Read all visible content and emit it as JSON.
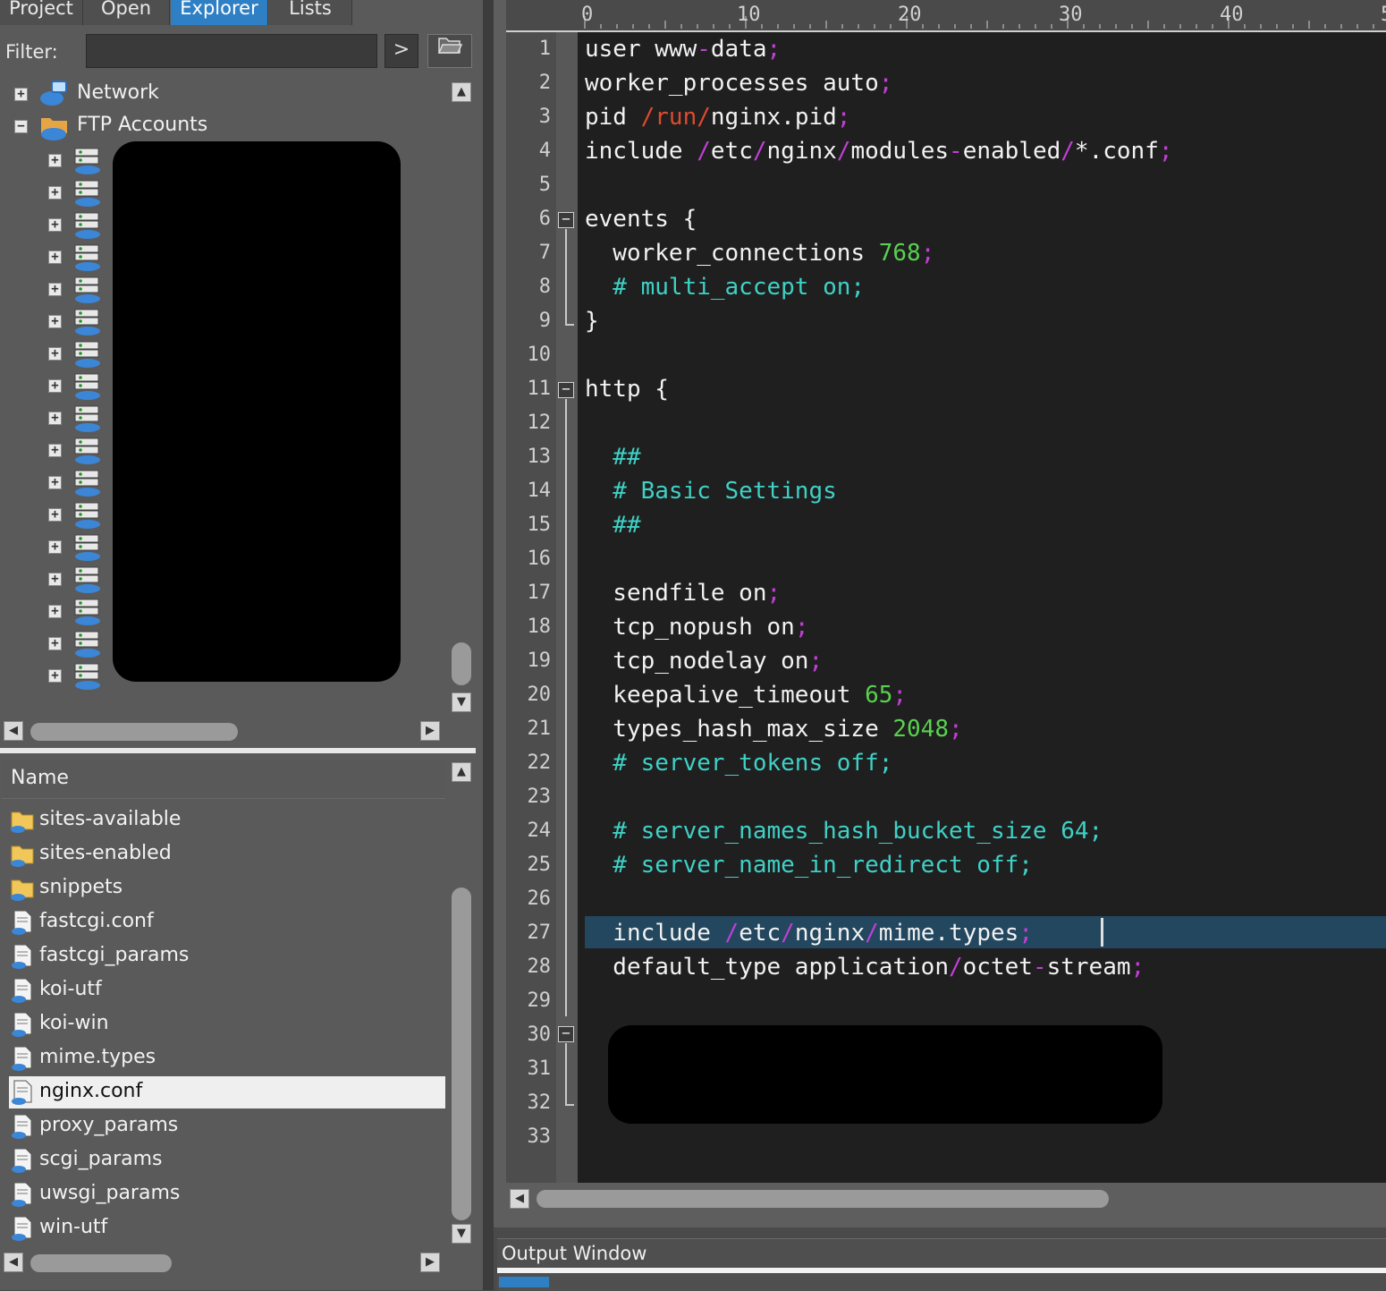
{
  "left_panel": {
    "tabs": [
      "Project",
      "Open",
      "Explorer",
      "Lists"
    ],
    "active_tab": "Explorer",
    "filter": {
      "label": "Filter:",
      "value": "",
      "go_glyph": ">"
    },
    "tree": {
      "network_label": "Network",
      "ftp_label": "FTP Accounts",
      "ftp_child_count": 17
    },
    "files": {
      "header": "Name",
      "items": [
        {
          "name": "sites-available",
          "type": "folder"
        },
        {
          "name": "sites-enabled",
          "type": "folder"
        },
        {
          "name": "snippets",
          "type": "folder"
        },
        {
          "name": "fastcgi.conf",
          "type": "file"
        },
        {
          "name": "fastcgi_params",
          "type": "file"
        },
        {
          "name": "koi-utf",
          "type": "file"
        },
        {
          "name": "koi-win",
          "type": "file"
        },
        {
          "name": "mime.types",
          "type": "file"
        },
        {
          "name": "nginx.conf",
          "type": "file",
          "selected": true
        },
        {
          "name": "proxy_params",
          "type": "file"
        },
        {
          "name": "scgi_params",
          "type": "file"
        },
        {
          "name": "uwsgi_params",
          "type": "file"
        },
        {
          "name": "win-utf",
          "type": "file"
        }
      ]
    }
  },
  "editor": {
    "ruler_marks": [
      "0",
      "10",
      "20",
      "30",
      "40",
      "5"
    ],
    "current_line": 27,
    "line_count": 33,
    "lines": [
      [
        [
          "user www",
          "p"
        ],
        [
          "-",
          "s"
        ],
        [
          "data",
          "p"
        ],
        [
          ";",
          "s"
        ]
      ],
      [
        [
          "worker_processes auto",
          "p"
        ],
        [
          ";",
          "s"
        ]
      ],
      [
        [
          "pid ",
          "p"
        ],
        [
          "/run/",
          "r"
        ],
        [
          "nginx.pid",
          "p"
        ],
        [
          ";",
          "s"
        ]
      ],
      [
        [
          "include ",
          "p"
        ],
        [
          "/",
          "s"
        ],
        [
          "etc",
          "p"
        ],
        [
          "/",
          "s"
        ],
        [
          "nginx",
          "p"
        ],
        [
          "/",
          "s"
        ],
        [
          "modules",
          "p"
        ],
        [
          "-",
          "s"
        ],
        [
          "enabled",
          "p"
        ],
        [
          "/",
          "s"
        ],
        [
          "*.conf",
          "p"
        ],
        [
          ";",
          "s"
        ]
      ],
      [],
      [
        [
          "events {",
          "p"
        ]
      ],
      [
        [
          "  worker_connections ",
          "p"
        ],
        [
          "768",
          "n"
        ],
        [
          ";",
          "s"
        ]
      ],
      [
        [
          "  # multi_accept on;",
          "c"
        ]
      ],
      [
        [
          "}",
          "p"
        ]
      ],
      [],
      [
        [
          "http {",
          "p"
        ]
      ],
      [],
      [
        [
          "  ##",
          "c"
        ]
      ],
      [
        [
          "  # Basic Settings",
          "c"
        ]
      ],
      [
        [
          "  ##",
          "c"
        ]
      ],
      [],
      [
        [
          "  sendfile on",
          "p"
        ],
        [
          ";",
          "s"
        ]
      ],
      [
        [
          "  tcp_nopush on",
          "p"
        ],
        [
          ";",
          "s"
        ]
      ],
      [
        [
          "  tcp_nodelay on",
          "p"
        ],
        [
          ";",
          "s"
        ]
      ],
      [
        [
          "  keepalive_timeout ",
          "p"
        ],
        [
          "65",
          "n"
        ],
        [
          ";",
          "s"
        ]
      ],
      [
        [
          "  types_hash_max_size ",
          "p"
        ],
        [
          "2048",
          "n"
        ],
        [
          ";",
          "s"
        ]
      ],
      [
        [
          "  # server_tokens off;",
          "c"
        ]
      ],
      [],
      [
        [
          "  # server_names_hash_bucket_size 64;",
          "c"
        ]
      ],
      [
        [
          "  # server_name_in_redirect off;",
          "c"
        ]
      ],
      [],
      [
        [
          "  include ",
          "p"
        ],
        [
          "/",
          "s"
        ],
        [
          "etc",
          "p"
        ],
        [
          "/",
          "s"
        ],
        [
          "nginx",
          "p"
        ],
        [
          "/",
          "s"
        ],
        [
          "mime.types",
          "p"
        ],
        [
          ";",
          "s"
        ]
      ],
      [
        [
          "  default_type application",
          "p"
        ],
        [
          "/",
          "s"
        ],
        [
          "octet",
          "p"
        ],
        [
          "-",
          "s"
        ],
        [
          "stream",
          "p"
        ],
        [
          ";",
          "s"
        ]
      ],
      [],
      [],
      [],
      [],
      []
    ]
  },
  "output_window": {
    "title": "Output Window"
  },
  "colors": {
    "accent_tab": "#2f7fc4",
    "code_background": "#1f1f1f",
    "separator": "#c23fd6",
    "path": "#e04a2f",
    "number": "#59d14f",
    "comment": "#3fd1c6",
    "current_line": "#22475e"
  }
}
